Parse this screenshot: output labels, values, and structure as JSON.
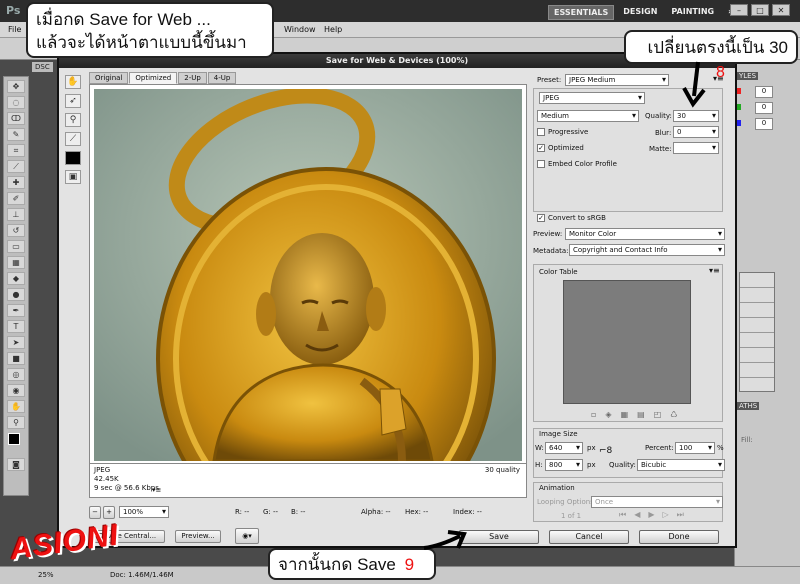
{
  "photoshop": {
    "logo": "Ps",
    "workspaces": [
      "ESSENTIALS",
      "DESIGN",
      "PAINTING",
      "»"
    ],
    "menu": [
      "File",
      "Window",
      "Help"
    ],
    "doc_tab": "DSC",
    "status": {
      "zoom": "25%",
      "doc": "Doc: 1.46M/1.46M"
    },
    "right_panel": {
      "styles_label": "YLES",
      "values": [
        "0",
        "0",
        "0"
      ],
      "fill_label": "Fill:",
      "paths_label": "ATHS"
    }
  },
  "dialog": {
    "title": "Save for Web & Devices (100%)",
    "tabs": [
      "Original",
      "Optimized",
      "2-Up",
      "4-Up"
    ],
    "active_tab": "Optimized",
    "image_info": {
      "format": "JPEG",
      "size": "42.45K",
      "time": "9 sec @ 56.6 Kbps",
      "quality_text": "30 quality"
    },
    "zoom": "100%",
    "readouts": {
      "r": "R: --",
      "g": "G: --",
      "b": "B: --",
      "alpha": "Alpha: --",
      "hex": "Hex: --",
      "index": "Index: --"
    },
    "left_buttons": {
      "device_central": "Device Central...",
      "preview": "Preview..."
    },
    "settings": {
      "preset_label": "Preset:",
      "preset": "JPEG Medium",
      "format": "JPEG",
      "quality_mode": "Medium",
      "quality_label": "Quality:",
      "quality": "30",
      "progressive": "Progressive",
      "blur_label": "Blur:",
      "blur": "0",
      "optimized": "Optimized",
      "matte_label": "Matte:",
      "embed": "Embed Color Profile",
      "convert": "Convert to sRGB",
      "preview_label": "Preview:",
      "preview": "Monitor Color",
      "metadata_label": "Metadata:",
      "metadata": "Copyright and Contact Info",
      "color_table": "Color Table",
      "image_size": "Image Size",
      "w_label": "W:",
      "w": "640",
      "h_label": "H:",
      "h": "800",
      "px": "px",
      "percent_label": "Percent:",
      "percent": "100",
      "pct": "%",
      "quality2_label": "Quality:",
      "quality2": "Bicubic",
      "animation": "Animation",
      "looping_label": "Looping Options:",
      "looping": "Once",
      "frame": "1 of 1"
    },
    "buttons": {
      "save": "Save",
      "cancel": "Cancel",
      "done": "Done"
    }
  },
  "annotations": {
    "top_left_line1": "เมื่อกด Save for Web ...",
    "top_left_line2": "แล้วจะได้หน้าตาแบบนี้ขึ้นมา",
    "top_right": "เปลี่ยนตรงนี้เป็น 30",
    "step8": "8",
    "bottom": "จากนั้นกด Save",
    "step9": "9",
    "brand": "ASIONI"
  },
  "colors": {
    "annotation_number": "#e11111",
    "brand": "#e11111",
    "titlebar": "#2a2a2a"
  }
}
